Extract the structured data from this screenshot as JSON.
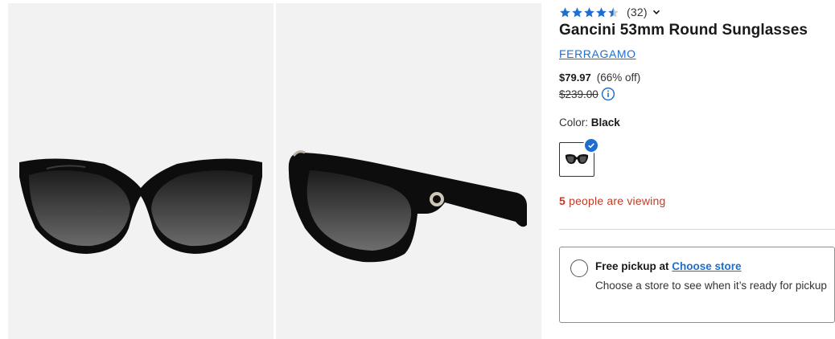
{
  "gallery": {
    "images": [
      {
        "alt": "front view"
      },
      {
        "alt": "side view"
      }
    ]
  },
  "product": {
    "rating": 4.5,
    "review_count": "(32)",
    "title": "Gancini 53mm Round Sunglasses",
    "brand": "FERRAGAMO",
    "price": "$79.97",
    "discount": "(66% off)",
    "original_price": "$239.00",
    "color_label": "Color:",
    "color_value": "Black",
    "viewing_count": "5",
    "viewing_text": " people are viewing"
  },
  "pickup": {
    "head": "Free pickup at ",
    "link": "Choose store",
    "sub": "Choose a store to see when it’s ready for pickup"
  },
  "colors": {
    "accent": "#1e6ed0",
    "alert": "#c43a24",
    "star": "#1e6ed0"
  }
}
